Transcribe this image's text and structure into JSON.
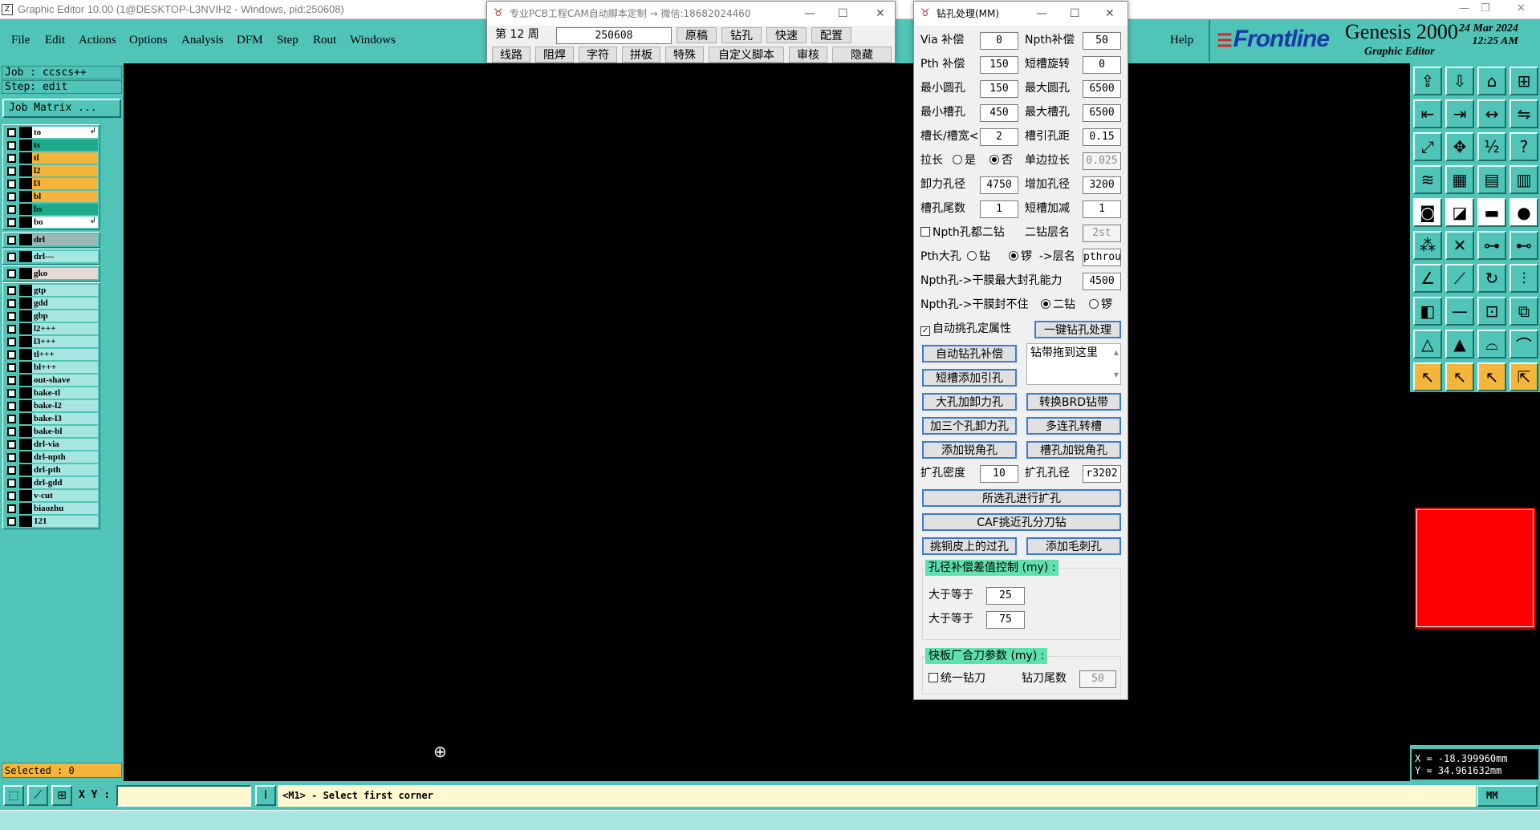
{
  "window": {
    "title": "Graphic Editor 10.00 (1@DESKTOP-L3NVIH2 - Windows, pid:250608)"
  },
  "menu": [
    "File",
    "Edit",
    "Actions",
    "Options",
    "Analysis",
    "DFM",
    "Step",
    "Rout",
    "Windows"
  ],
  "help_label": "Help",
  "brand": {
    "logo": "Frontline",
    "product": "Genesis 2000",
    "subtitle": "Graphic Editor",
    "date": "24 Mar 2024",
    "time": "12:25 AM"
  },
  "job": {
    "job_label": "Job : ccscs++",
    "step_label": "Step: edit",
    "matrix_label": "Job Matrix ..."
  },
  "layers": {
    "group1": [
      {
        "name": "to",
        "color": "#ffffff",
        "arrow": true
      },
      {
        "name": "ts",
        "color": "#1faa8c"
      },
      {
        "name": "tl",
        "color": "#f5b53a"
      },
      {
        "name": "l2",
        "color": "#f5b53a"
      },
      {
        "name": "l3",
        "color": "#f5b53a"
      },
      {
        "name": "bl",
        "color": "#f5b53a"
      },
      {
        "name": "bs",
        "color": "#1faa8c"
      },
      {
        "name": "bo",
        "color": "#ffffff",
        "arrow": true
      }
    ],
    "group2": [
      {
        "name": "drl",
        "color": "#9bb8b5"
      }
    ],
    "group3": [
      {
        "name": "drl---",
        "color": "#a6e6e0"
      }
    ],
    "group4": [
      {
        "name": "gko",
        "color": "#e6d8d2"
      }
    ],
    "group5": [
      {
        "name": "gtp"
      },
      {
        "name": "gdd"
      },
      {
        "name": "gbp"
      },
      {
        "name": "l2+++"
      },
      {
        "name": "l3+++"
      },
      {
        "name": "tl+++"
      },
      {
        "name": "bl+++"
      },
      {
        "name": "out-shave"
      },
      {
        "name": "bake-tl"
      },
      {
        "name": "bake-l2"
      },
      {
        "name": "bake-l3"
      },
      {
        "name": "bake-bl"
      },
      {
        "name": "drl-via"
      },
      {
        "name": "drl-npth"
      },
      {
        "name": "drl-pth"
      },
      {
        "name": "drl-gdd"
      },
      {
        "name": "v-cut"
      },
      {
        "name": "biaozhu"
      },
      {
        "name": "121"
      }
    ]
  },
  "selected_label": "Selected : 0",
  "coords": {
    "x": "X = -18.399960mm",
    "y": "Y =  34.961632mm"
  },
  "status": {
    "xy_label": "X Y :",
    "xy_value": "",
    "message": "<M1> - Select first corner",
    "units": "MM"
  },
  "script_window": {
    "title": "专业PCB工程CAM自动脚本定制 → 微信:18682024460",
    "week_label": "第 12 周",
    "week_value": "250608",
    "row1": [
      "原稿",
      "钻孔",
      "快速",
      "配置"
    ],
    "row2": [
      "线路",
      "阻焊",
      "字符",
      "拼板",
      "特殊",
      "自定义脚本",
      "审核",
      "隐藏"
    ]
  },
  "drill_window": {
    "title": "钻孔处理(MM)",
    "fields": [
      {
        "l1": "Via 补偿",
        "v1": "0",
        "l2": "Npth补偿",
        "v2": "50"
      },
      {
        "l1": "Pth 补偿",
        "v1": "150",
        "l2": "短槽旋转",
        "v2": "0"
      },
      {
        "l1": "最小圆孔",
        "v1": "150",
        "l2": "最大圆孔",
        "v2": "6500"
      },
      {
        "l1": "最小槽孔",
        "v1": "450",
        "l2": "最大槽孔",
        "v2": "6500"
      },
      {
        "l1": "槽长/槽宽<",
        "v1": "2",
        "l2": "槽引孔距",
        "v2": "0.15"
      }
    ],
    "stretch_label": "拉长",
    "stretch_yes": "是",
    "stretch_no": "否",
    "single_side_label": "单边拉长",
    "single_side_value": "0.025",
    "fields2": [
      {
        "l1": "卸力孔径",
        "v1": "4750",
        "l2": "增加孔径",
        "v2": "3200"
      },
      {
        "l1": "槽孔尾数",
        "v1": "1",
        "l2": "短槽加减",
        "v2": "1"
      }
    ],
    "npth_second": "Npth孔都二钻",
    "second_layer_label": "二钻层名",
    "second_layer_value": "2st",
    "pth_big_label": "Pth大孔",
    "pth_drill": "钻",
    "pth_rout": "锣",
    "layer_name_label": "->层名",
    "layer_name_value": "pthrout",
    "npth_dry_label": "Npth孔->干膜最大封孔能力",
    "npth_dry_value": "4500",
    "npth_cover_label": "Npth孔->干膜封不住",
    "opt_second": "二钻",
    "opt_rout": "锣",
    "auto_attr": "自动挑孔定属性",
    "one_key": "一键钻孔处理",
    "drop_label": "钻带拖到这里",
    "btn_pairs": [
      [
        "自动钻孔补偿",
        ""
      ],
      [
        "短槽添加引孔",
        ""
      ],
      [
        "大孔加卸力孔",
        "转换BRD钻带"
      ],
      [
        "加三个孔卸力孔",
        "多连孔转槽"
      ],
      [
        "添加锐角孔",
        "槽孔加锐角孔"
      ]
    ],
    "expand_density_label": "扩孔密度",
    "expand_density_value": "10",
    "expand_dia_label": "扩孔孔径",
    "expand_dia_value": "r3202",
    "selected_expand": "所选孔进行扩孔",
    "caf": "CAF挑近孔分刀钻",
    "copper_via": "挑铜皮上的过孔",
    "burr": "添加毛刺孔",
    "group_comp_title": "孔径补偿差值控制 (my) :",
    "ge_label": "大于等于",
    "ge1": "25",
    "ge2": "75",
    "group_fast_title": "快板厂合刀参数 (my) :",
    "unify": "统一钻刀",
    "tail_label": "钻刀尾数",
    "tail_value": "50"
  }
}
